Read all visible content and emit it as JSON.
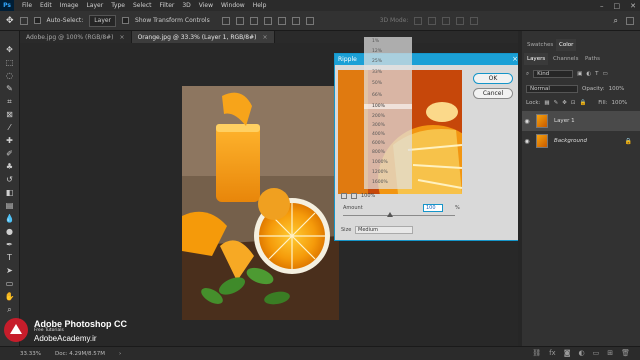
{
  "app": {
    "logo": "Ps",
    "menu": [
      "File",
      "Edit",
      "Image",
      "Layer",
      "Type",
      "Select",
      "Filter",
      "3D",
      "View",
      "Window",
      "Help"
    ],
    "window_controls": [
      "minimize-icon",
      "maximize-icon",
      "close-icon"
    ]
  },
  "options": {
    "auto_select_label": "Auto-Select:",
    "auto_select_value": "Layer",
    "transform_label": "Show Transform Controls",
    "mode_3d": "3D Mode:"
  },
  "tabs": [
    {
      "label": "Adobe.jpg @ 100% (RGB/8#)",
      "close": "×"
    },
    {
      "label": "Orange.jpg @ 33.3% (Layer 1, RGB/8#)",
      "close": "×"
    }
  ],
  "dialog": {
    "title": "Ripple",
    "close": "×",
    "ok": "OK",
    "cancel": "Cancel",
    "zoom_value": "100%",
    "amount_label": "Amount",
    "amount_value": "100",
    "amount_unit": "%",
    "amount_fraction": 0.42,
    "size_label": "Size",
    "size_value": "Medium",
    "zoom_options": [
      "1%",
      "12%",
      "25%",
      "33%",
      "50%",
      "66%",
      "100%",
      "200%",
      "300%",
      "400%",
      "600%",
      "800%",
      "1000%",
      "1200%",
      "1600%"
    ],
    "zoom_highlight": "100%"
  },
  "right_panels": {
    "top_tabs": [
      "Swatches",
      "Color"
    ],
    "tabs": [
      "Layers",
      "Channels",
      "Paths"
    ],
    "kind_label": "Kind",
    "blend_mode": "Normal",
    "opacity_label": "Opacity:",
    "opacity_value": "100%",
    "lock_label": "Lock:",
    "fill_label": "Fill:",
    "fill_value": "100%",
    "layers": [
      {
        "name": "Layer 1",
        "visible": true,
        "selected": true
      },
      {
        "name": "Background",
        "visible": true,
        "selected": false,
        "locked": true
      }
    ]
  },
  "status": {
    "zoom": "33.33%",
    "doc": "Doc: 4.29M/8.57M"
  },
  "watermark": {
    "title": "Adobe Photoshop CC",
    "subtitle": "Free Tutorials",
    "site": "AdobeAcademy.ir"
  },
  "colors": {
    "dialog_accent": "#1ba0d6",
    "orange": "#f6a20d",
    "brand_red": "#c71d2b"
  }
}
